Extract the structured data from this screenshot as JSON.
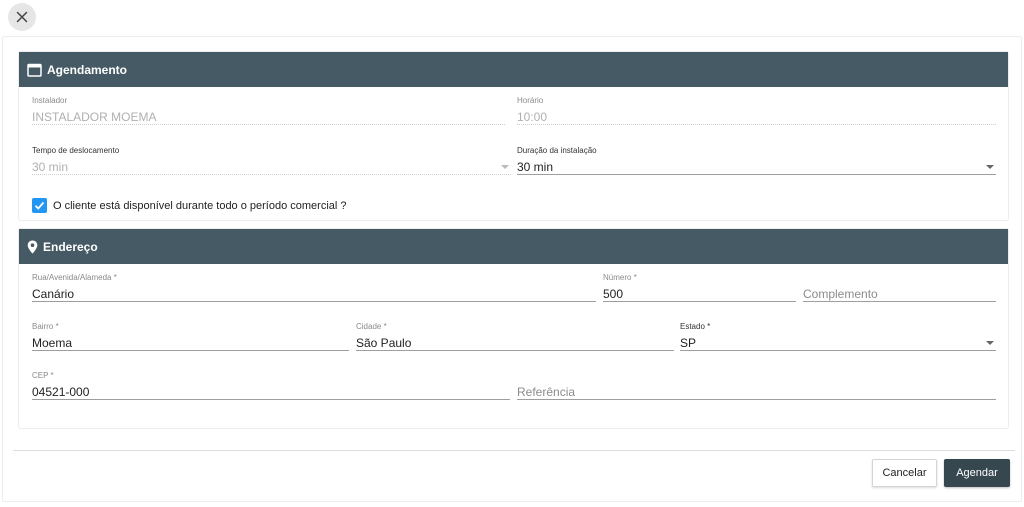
{
  "dialog": {
    "close_icon": "close-icon"
  },
  "agendamento": {
    "title": "Agendamento",
    "icon": "calendar-icon",
    "instalador": {
      "label": "Instalador",
      "value": "INSTALADOR MOEMA"
    },
    "horario": {
      "label": "Horário",
      "value": "10:00"
    },
    "tempo_deslocamento": {
      "label": "Tempo de deslocamento",
      "value": "30 min"
    },
    "duracao_instalacao": {
      "label": "Duração da instalação",
      "value": "30 min"
    },
    "disponivel": {
      "label": "O cliente está disponível durante todo o período comercial ?",
      "checked": true
    }
  },
  "endereco": {
    "title": "Endereço",
    "icon": "map-pin-icon",
    "rua": {
      "label": "Rua/Avenida/Alameda *",
      "value": "Canário"
    },
    "numero": {
      "label": "Número *",
      "value": "500"
    },
    "complemento": {
      "placeholder": "Complemento"
    },
    "bairro": {
      "label": "Bairro *",
      "value": "Moema"
    },
    "cidade": {
      "label": "Cidade *",
      "value": "São Paulo"
    },
    "estado": {
      "label": "Estado *",
      "value": "SP"
    },
    "cep": {
      "label": "CEP *",
      "value": "04521-000"
    },
    "referencia": {
      "placeholder": "Referência"
    }
  },
  "actions": {
    "cancel_label": "Cancelar",
    "submit_label": "Agendar"
  },
  "colors": {
    "header_bg": "#455a64",
    "checkbox": "#2196f3",
    "primary_button": "#37474f"
  }
}
